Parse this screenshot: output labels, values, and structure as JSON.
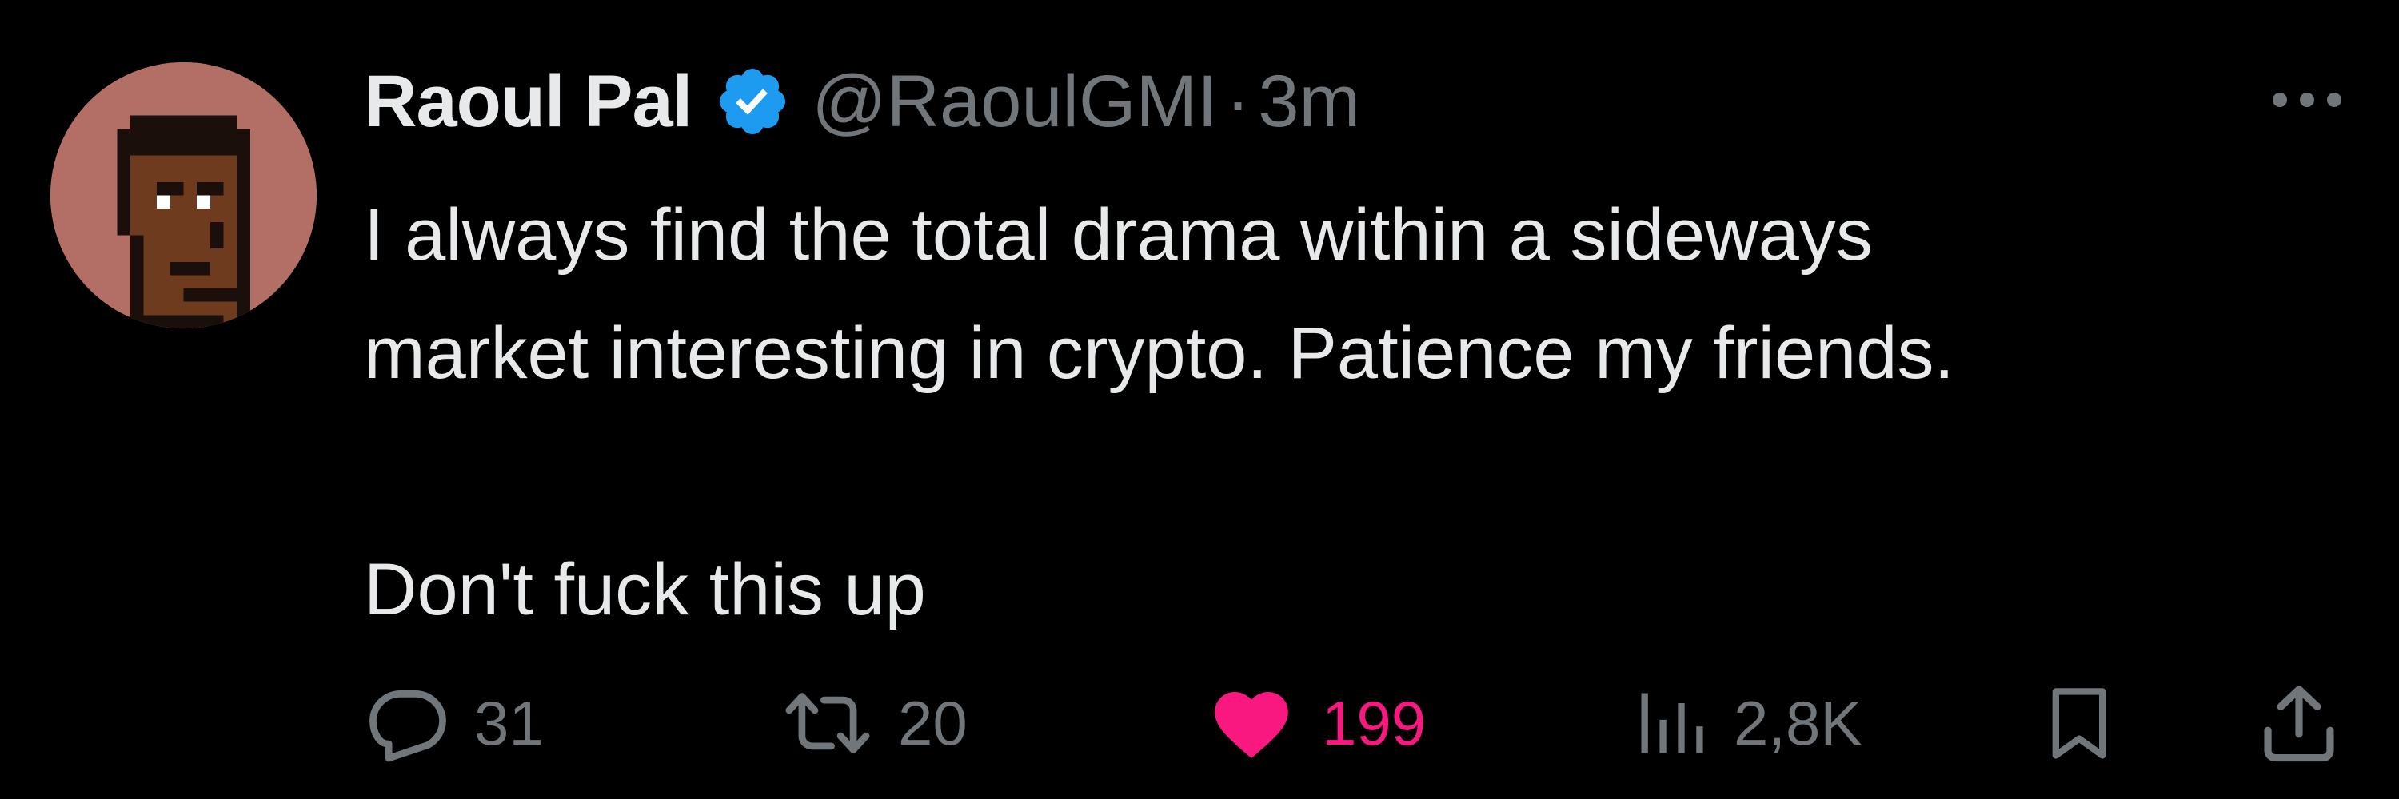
{
  "tweet": {
    "author": {
      "display_name": "Raoul Pal",
      "handle": "@RaoulGMI",
      "verified": true
    },
    "separator": "·",
    "timestamp": "3m",
    "body": {
      "line1": "I always find the total drama within a sideways",
      "line2": "market interesting in crypto. Patience my friends.",
      "line3": "Don't fuck this up"
    },
    "actions": {
      "replies": "31",
      "retweets": "20",
      "likes": "199",
      "views": "2,8K"
    }
  },
  "icons": {
    "verified": "verified-badge-icon",
    "more": "more-options-icon",
    "reply": "reply-icon",
    "retweet": "retweet-icon",
    "like": "heart-icon",
    "views": "views-icon",
    "bookmark": "bookmark-icon",
    "share": "share-icon"
  },
  "colors": {
    "background": "#000000",
    "text_primary": "#e7e9ea",
    "text_secondary": "#71767b",
    "verified": "#1d9bf0",
    "like_active": "#f91880",
    "avatar_bg": "#b36f66"
  }
}
